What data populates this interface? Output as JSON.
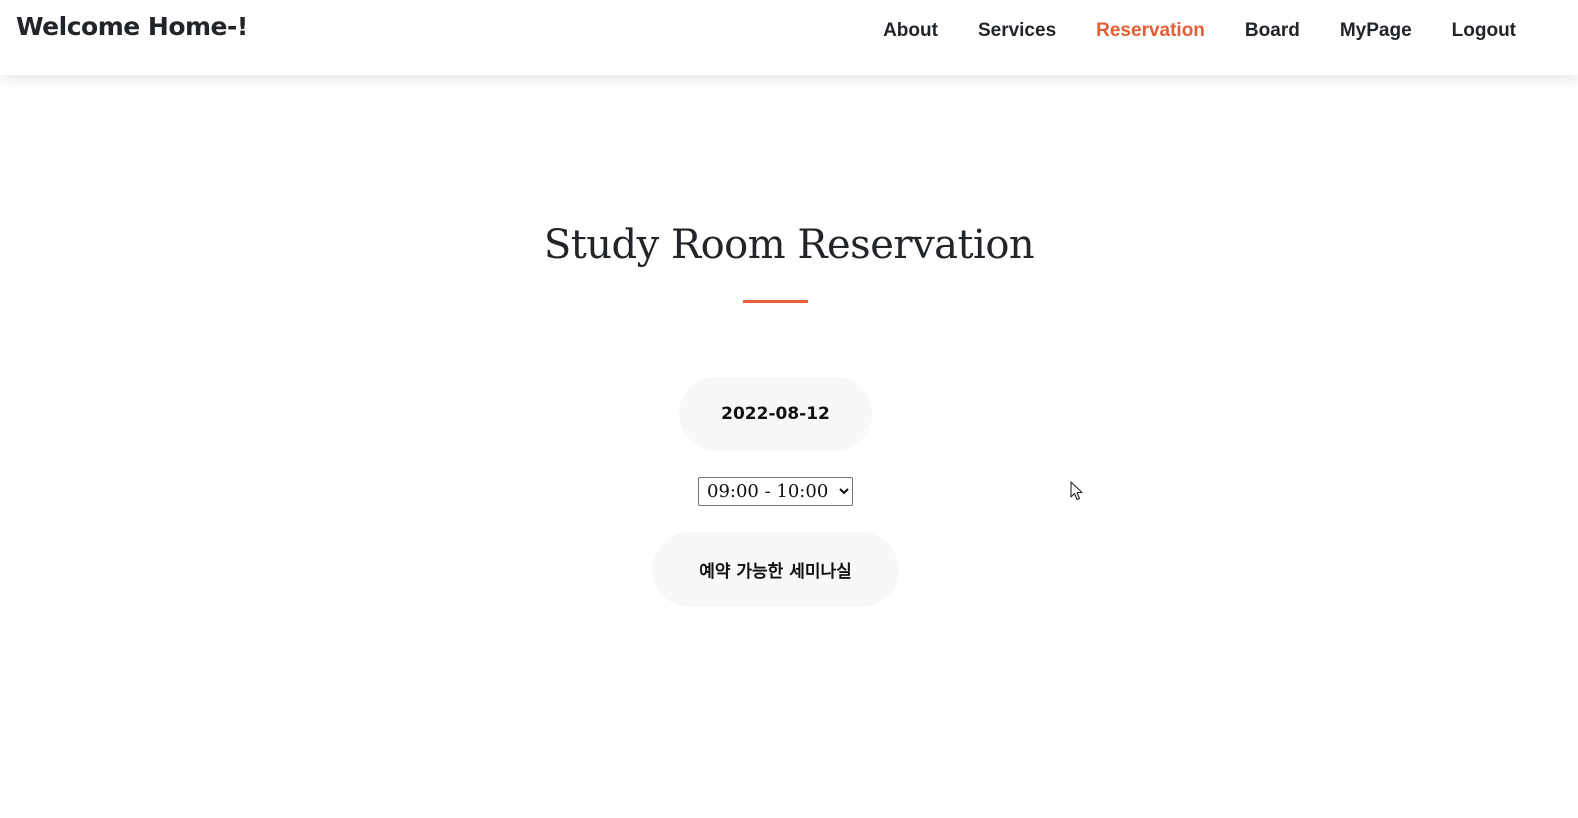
{
  "navbar": {
    "brand": "Welcome Home-!",
    "items": [
      {
        "label": "About",
        "active": false
      },
      {
        "label": "Services",
        "active": false
      },
      {
        "label": "Reservation",
        "active": true
      },
      {
        "label": "Board",
        "active": false
      },
      {
        "label": "MyPage",
        "active": false
      },
      {
        "label": "Logout",
        "active": false
      }
    ]
  },
  "main": {
    "title": "Study Room Reservation",
    "date": "2022-08-12",
    "time_select": {
      "selected": "09:00 - 10:00"
    },
    "room_button_label": "예약 가능한 세미나실"
  },
  "colors": {
    "accent": "#e35d36",
    "text": "#212529",
    "pill_bg": "#f7f8fa"
  },
  "icons": {
    "cursor": "mouse-pointer-icon"
  }
}
